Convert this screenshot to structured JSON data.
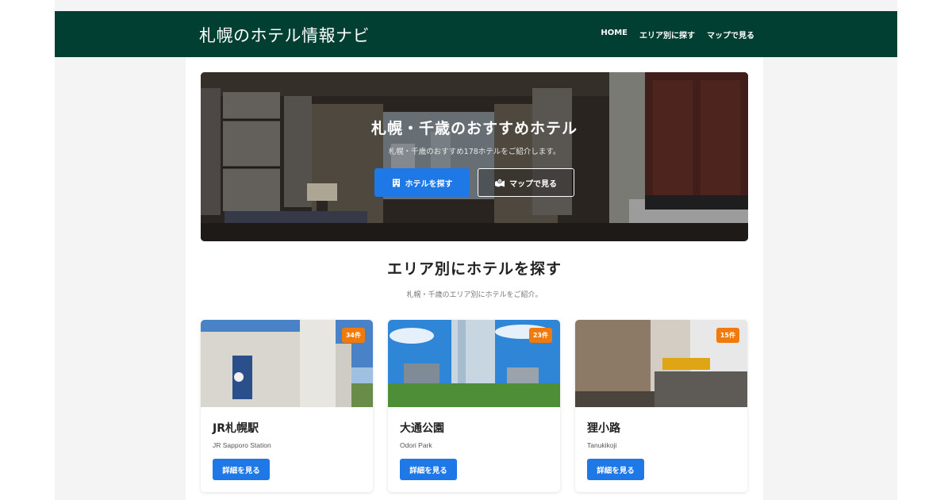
{
  "header": {
    "logo": "札幌のホテル情報ナビ",
    "nav": [
      "HOME",
      "エリア別に探す",
      "マップで見る"
    ]
  },
  "hero": {
    "title": "札幌・千歳のおすすめホテル",
    "subtitle": "札幌・千歳のおすすめ178ホテルをご紹介します。",
    "btn_hotel": "ホテルを探す",
    "btn_hotel_icon": "building-icon",
    "btn_map": "マップで見る",
    "btn_map_icon": "map-icon"
  },
  "areas": {
    "title": "エリア別にホテルを探す",
    "subtitle": "札幌・千歳のエリア別にホテルをご紹介。",
    "cards": [
      {
        "name": "JR札幌駅",
        "en": "JR Sapporo Station",
        "count": "34件",
        "button": "詳細を見る"
      },
      {
        "name": "大通公園",
        "en": "Odori Park",
        "count": "23件",
        "button": "詳細を見る"
      },
      {
        "name": "狸小路",
        "en": "Tanukikoji",
        "count": "15件",
        "button": "詳細を見る"
      }
    ]
  },
  "colors": {
    "header_bg": "#003f31",
    "primary": "#1e78e6",
    "badge": "#f07a0c"
  }
}
